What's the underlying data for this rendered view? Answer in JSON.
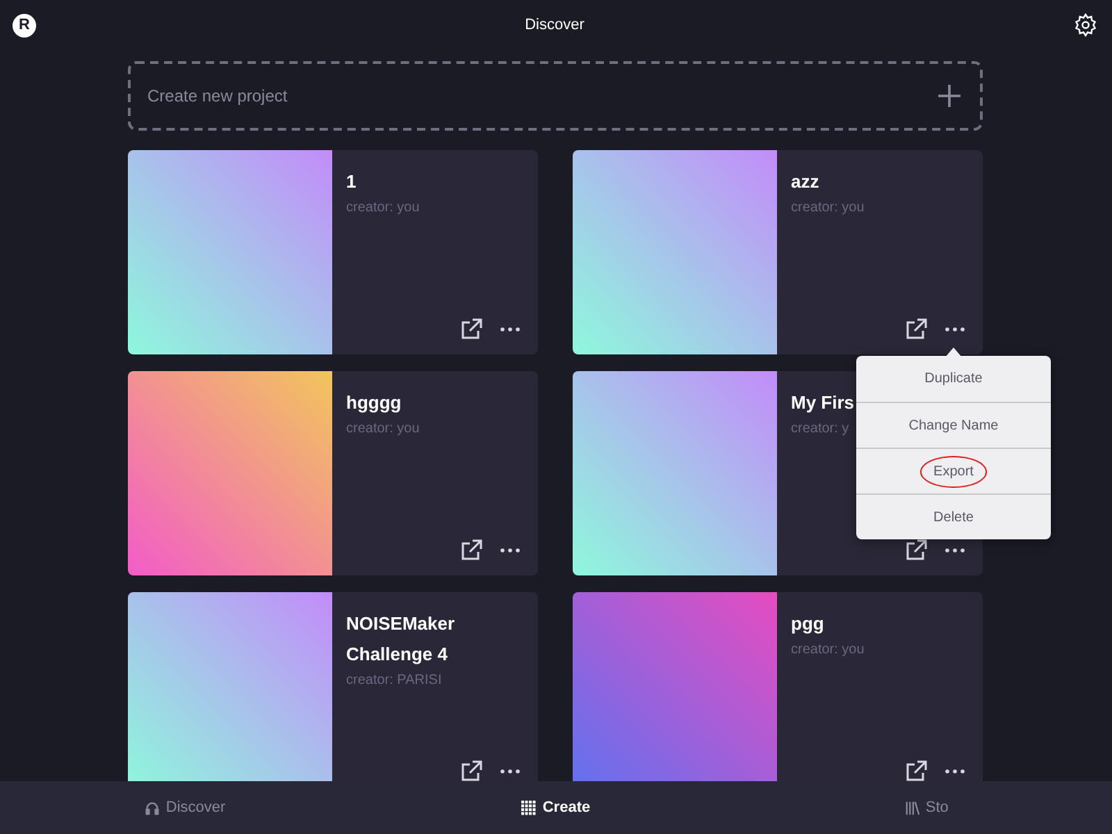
{
  "header": {
    "logo": "R",
    "title": "Discover"
  },
  "create_project": {
    "label": "Create new project"
  },
  "projects": [
    {
      "title": "1",
      "creator": "creator: you",
      "kind": "cool"
    },
    {
      "title": "azz",
      "creator": "creator: you",
      "kind": "cool"
    },
    {
      "title": "hgggg",
      "creator": "creator: you",
      "kind": "warm"
    },
    {
      "title": "My Firs",
      "creator": "creator: y",
      "kind": "cool"
    },
    {
      "title": "NOISEMaker Challenge 4",
      "creator": "creator: PARISI",
      "kind": "cool"
    },
    {
      "title": "pgg",
      "creator": "creator: you",
      "kind": "violet"
    }
  ],
  "context_menu": {
    "items": [
      {
        "label": "Duplicate",
        "highlighted": false
      },
      {
        "label": "Change Name",
        "highlighted": false
      },
      {
        "label": "Export",
        "highlighted": true
      },
      {
        "label": "Delete",
        "highlighted": false
      }
    ]
  },
  "tab_bar": [
    {
      "label": "Discover",
      "kind": "listen",
      "selected": false
    },
    {
      "label": "Create",
      "kind": "create",
      "selected": true
    },
    {
      "label": "Sto",
      "kind": "store",
      "selected": false
    }
  ]
}
